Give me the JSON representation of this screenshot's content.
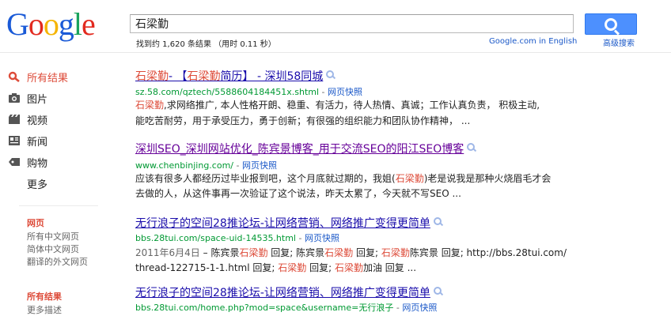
{
  "logo": {
    "letters": [
      "G",
      "o",
      "o",
      "g",
      "l",
      "e"
    ],
    "colors": [
      "#1a5ad7",
      "#e22a1f",
      "#f5b400",
      "#1a5ad7",
      "#19a35d",
      "#e22a1f"
    ]
  },
  "search": {
    "query": "石梁勤",
    "button_icon": "search-icon"
  },
  "stats": {
    "text": "找到约 1,620 条结果 （用时 0.11 秒）"
  },
  "links": {
    "google_english": "Google.com in English",
    "advanced": "高级搜索"
  },
  "nav": {
    "items": [
      {
        "label": "所有结果",
        "icon": "search-icon"
      },
      {
        "label": "图片",
        "icon": "camera-icon"
      },
      {
        "label": "视频",
        "icon": "film-icon"
      },
      {
        "label": "新闻",
        "icon": "newspaper-icon"
      },
      {
        "label": "购物",
        "icon": "tag-icon"
      },
      {
        "label": "更多",
        "icon": ""
      }
    ],
    "filters": [
      {
        "head": "网页",
        "items": [
          "所有中文网页",
          "简体中文网页",
          "翻译的外文网页"
        ]
      },
      {
        "head": "所有结果",
        "items": [
          "更多描述"
        ]
      }
    ]
  },
  "results": [
    {
      "title_parts": [
        "石梁勤",
        "- 【",
        "石梁勤",
        "简历】 - 深圳58同城"
      ],
      "url": "sz.58.com/qztech/5588604184451x.shtml",
      "sep": " - ",
      "cache": "网页快照",
      "lines": [
        [
          "石梁勤",
          ",求网络推广, 本人性格开朗、稳重、有活力，待人热情、真诚；工作认真负责， 积极主动,"
        ],
        [
          "",
          "能吃苦耐劳，用于承受压力，勇于创新；有很强的组织能力和团队协作精神， ..."
        ]
      ]
    },
    {
      "title": "深圳SEO_深圳网站优化_陈宾景博客_用于交流SEO的阳江SEO博客",
      "url": "www.chenbinjing.com/",
      "sep": " - ",
      "cache": "网页快照",
      "lines": [
        [
          "",
          "应该有很多人都经历过毕业报到吧，这个月底就过期的，我姐(",
          "石梁勤",
          ")老是说我是那种火烧眉毛才会"
        ],
        [
          "",
          "去做的人，从这件事再一次验证了这个说法，昨天太累了，今天就不写SEO ..."
        ]
      ]
    },
    {
      "title": "无行浪子的空间28推论坛-让网络营销、网络推广变得更简单",
      "url": "bbs.28tui.com/space-uid-14535.html",
      "sep": " - ",
      "cache": "网页快照",
      "lines": [
        [
          "2011年6月4日",
          " – 陈宾景",
          "石梁勤",
          " 回复; 陈宾景",
          "石梁勤",
          " 回复; ",
          "石梁勤",
          "陈宾景 回复; http://bbs.28tui.com/"
        ],
        [
          "",
          "thread-122715-1-1.html 回复; ",
          "石梁勤",
          " 回复; ",
          "石梁勤",
          "加油 回复 ..."
        ]
      ]
    },
    {
      "title": "无行浪子的空间28推论坛-让网络营销、网络推广变得更简单",
      "url": "bbs.28tui.com/home.php?mod=space&username=无行浪子",
      "sep": " - ",
      "cache": "网页快照"
    }
  ]
}
